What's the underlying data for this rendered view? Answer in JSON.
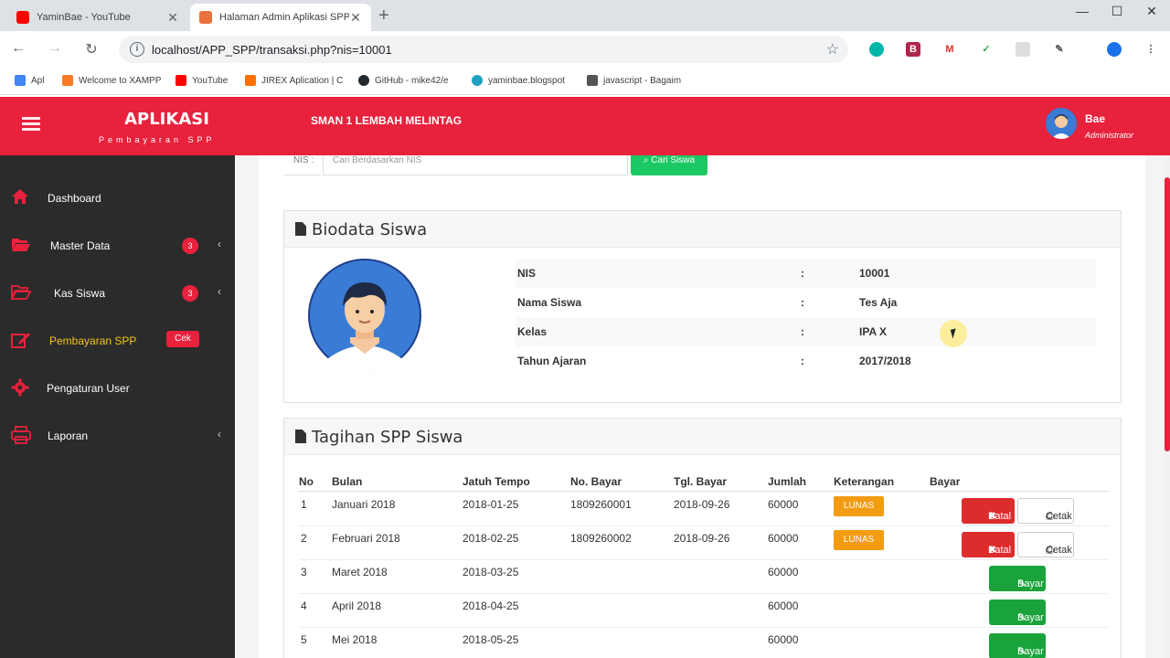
{
  "browser": {
    "tabs": [
      {
        "title": "YaminBae - YouTube",
        "active": false,
        "favicon_color": "#ff0000"
      },
      {
        "title": "Halaman Admin Aplikasi SPP",
        "active": true,
        "favicon_color": "#e8713c"
      }
    ],
    "url": "localhost/APP_SPP/transaksi.php?nis=10001",
    "bookmarks": [
      {
        "label": "Apl",
        "color": "#4285f4"
      },
      {
        "label": "Welcome to XAMPP",
        "color": "#fb7a24"
      },
      {
        "label": "YouTube",
        "color": "#ff0000"
      },
      {
        "label": "JIREX Aplication | C",
        "color": "#ff6f00"
      },
      {
        "label": "GitHub - mike42/e",
        "color": "#24292e"
      },
      {
        "label": "yaminbae.blogspot",
        "color": "#21a0c4"
      },
      {
        "label": "javascript - Bagaim",
        "color": "#555555"
      }
    ]
  },
  "header": {
    "app_title": "APLIKASI",
    "app_subtitle": "Pembayaran SPP",
    "school": "SMAN 1 LEMBAH MELINTAG",
    "user_name": "Bae",
    "user_role": "Administrator",
    "brand_color": "#e8213c"
  },
  "sidebar": {
    "items": [
      {
        "label": "Dashboard",
        "icon": "home-icon"
      },
      {
        "label": "Master Data",
        "icon": "folder-open-icon",
        "badge": "3"
      },
      {
        "label": "Kas Siswa",
        "icon": "folder-open-icon",
        "badge": "3"
      },
      {
        "label": "Pembayaran SPP",
        "icon": "edit-icon",
        "tag": "Cek",
        "active": true
      },
      {
        "label": "Pengaturan User",
        "icon": "gear-icon"
      },
      {
        "label": "Laporan",
        "icon": "print-icon"
      }
    ]
  },
  "search": {
    "label": "NIS :",
    "placeholder": "Cari Berdasarkan NIS",
    "button": "Cari Siswa"
  },
  "biodata": {
    "title": "Biodata Siswa",
    "rows": [
      {
        "key": "NIS",
        "value": "10001"
      },
      {
        "key": "Nama Siswa",
        "value": "Tes Aja"
      },
      {
        "key": "Kelas",
        "value": "IPA X"
      },
      {
        "key": "Tahun Ajaran",
        "value": "2017/2018"
      }
    ],
    "separator": ":"
  },
  "tagihan": {
    "title": "Tagihan SPP Siswa",
    "columns": [
      "No",
      "Bulan",
      "Jatuh Tempo",
      "No. Bayar",
      "Tgl. Bayar",
      "Jumlah",
      "Keterangan",
      "Bayar"
    ],
    "rows": [
      {
        "no": "1",
        "bulan": "Januari 2018",
        "jatuh_tempo": "2018-01-25",
        "no_bayar": "1809260001",
        "tgl_bayar": "2018-09-26",
        "jumlah": "60000",
        "keterangan": "LUNAS",
        "paid": true
      },
      {
        "no": "2",
        "bulan": "Februari 2018",
        "jatuh_tempo": "2018-02-25",
        "no_bayar": "1809260002",
        "tgl_bayar": "2018-09-26",
        "jumlah": "60000",
        "keterangan": "LUNAS",
        "paid": true
      },
      {
        "no": "3",
        "bulan": "Maret 2018",
        "jatuh_tempo": "2018-03-25",
        "no_bayar": "",
        "tgl_bayar": "",
        "jumlah": "60000",
        "keterangan": "",
        "paid": false
      },
      {
        "no": "4",
        "bulan": "April 2018",
        "jatuh_tempo": "2018-04-25",
        "no_bayar": "",
        "tgl_bayar": "",
        "jumlah": "60000",
        "keterangan": "",
        "paid": false
      },
      {
        "no": "5",
        "bulan": "Mei 2018",
        "jatuh_tempo": "2018-05-25",
        "no_bayar": "",
        "tgl_bayar": "",
        "jumlah": "60000",
        "keterangan": "",
        "paid": false
      }
    ],
    "batal_label": "Batal",
    "cetak_label": "Cetak",
    "bayar_label": "Bayar"
  }
}
